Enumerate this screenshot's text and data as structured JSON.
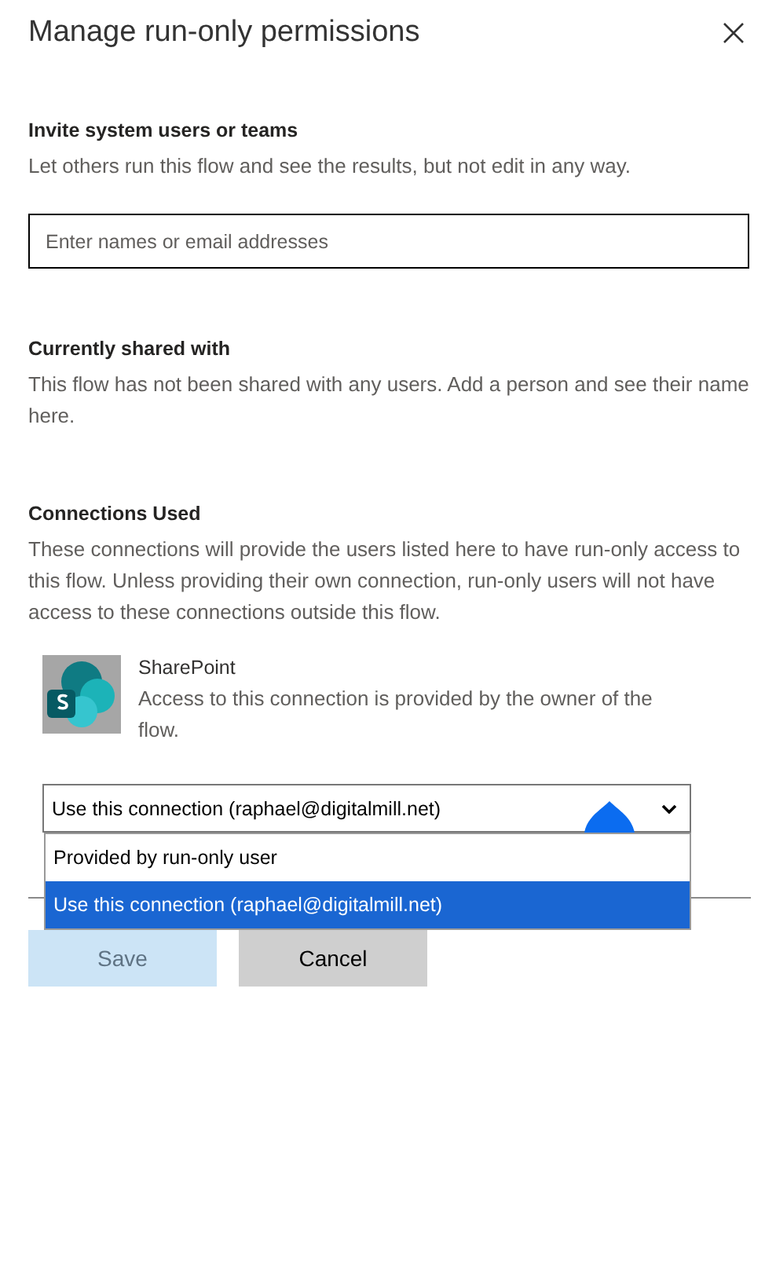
{
  "panel": {
    "title": "Manage run-only permissions"
  },
  "invite": {
    "heading": "Invite system users or teams",
    "description": "Let others run this flow and see the results, but not edit in any way.",
    "field": {
      "placeholder": "Enter names or email addresses"
    }
  },
  "shared": {
    "heading": "Currently shared with",
    "description": "This flow has not been shared with any users. Add a person and see their name here."
  },
  "connections": {
    "heading": "Connections Used",
    "description": "These connections will provide the users listed here to have run-only access to this flow. Unless providing their own connection, run-only users will not have access to these connections outside this flow.",
    "items": [
      {
        "name": "SharePoint",
        "description": "Access to this connection is provided by the owner of the flow.",
        "dropdown": {
          "value": "Use this connection (raphael@digitalmill.net)",
          "expanded": true,
          "options": [
            {
              "label": "Provided by run-only user",
              "selected": false
            },
            {
              "label": "Use this connection (raphael@digitalmill.net)",
              "selected": true
            }
          ]
        }
      }
    ]
  },
  "buttons": [
    {
      "label": "Save",
      "kind": "primary",
      "disabled": true
    },
    {
      "label": "Cancel",
      "kind": "secondary",
      "disabled": false
    }
  ]
}
